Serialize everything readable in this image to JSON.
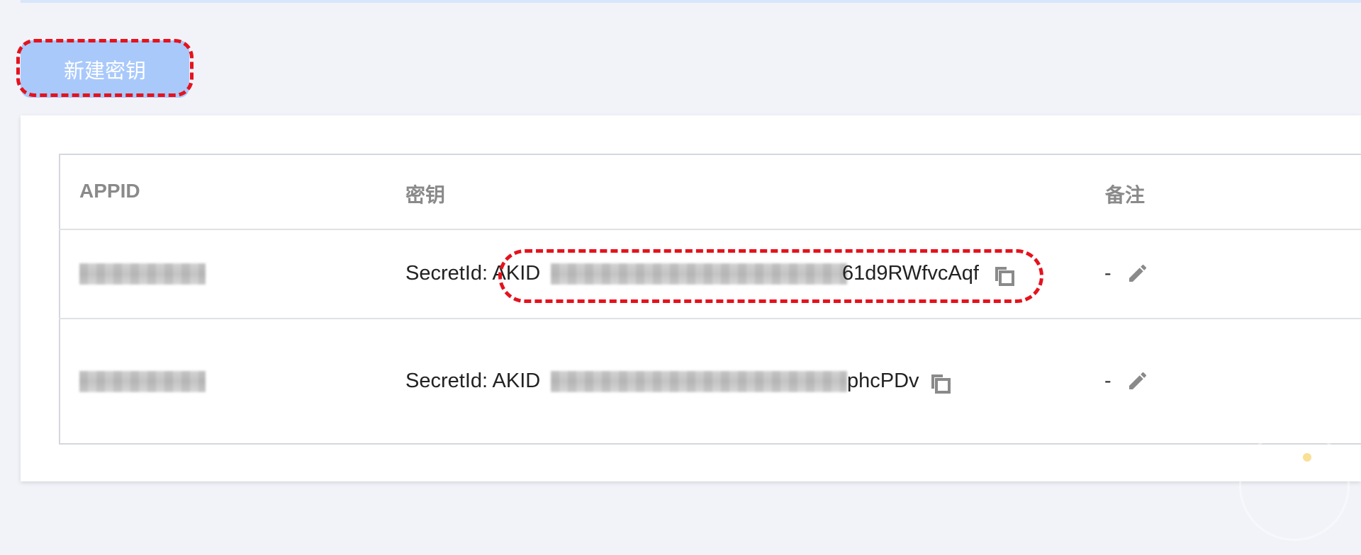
{
  "toolbar": {
    "new_key_label": "新建密钥"
  },
  "table": {
    "headers": [
      "APPID",
      "密钥",
      "备注"
    ],
    "rows": [
      {
        "secret_prefix": "SecretId: AKID",
        "secret_suffix": "61d9RWfvcAqf",
        "remark": "-"
      },
      {
        "secret_prefix": "SecretId: AKID",
        "secret_suffix": "phcPDv",
        "remark": "-"
      }
    ]
  },
  "colors": {
    "primary_disabled": "#a9c9fb",
    "highlight": "#e5121d",
    "header_text": "#8a8a8a"
  },
  "icons": [
    "copy-icon",
    "edit-icon"
  ]
}
